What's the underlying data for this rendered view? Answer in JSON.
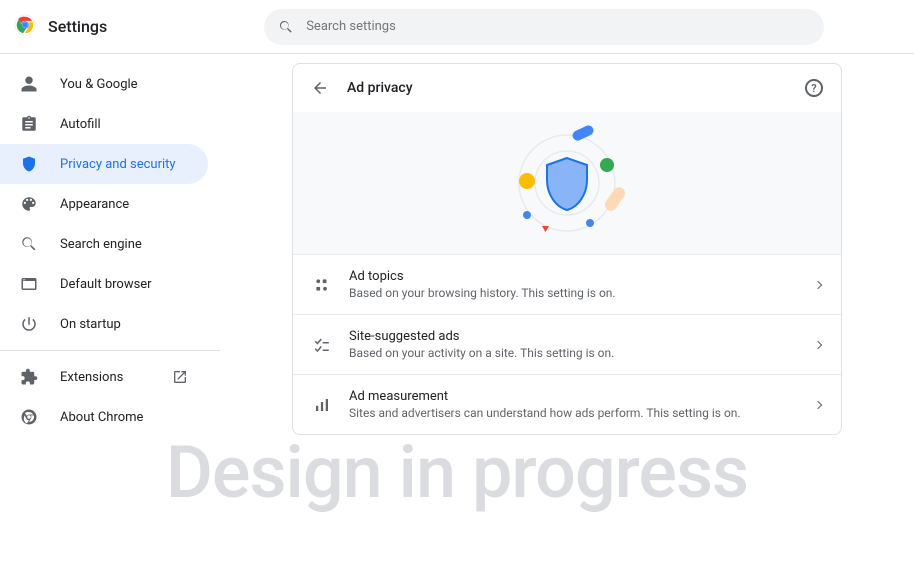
{
  "app": {
    "title": "Settings"
  },
  "search": {
    "placeholder": "Search settings"
  },
  "sidebar": {
    "items": [
      {
        "label": "You & Google"
      },
      {
        "label": "Autofill"
      },
      {
        "label": "Privacy and security"
      },
      {
        "label": "Appearance"
      },
      {
        "label": "Search engine"
      },
      {
        "label": "Default browser"
      },
      {
        "label": "On startup"
      }
    ],
    "footer": [
      {
        "label": "Extensions"
      },
      {
        "label": "About Chrome"
      }
    ]
  },
  "content": {
    "header_title": "Ad privacy",
    "rows": [
      {
        "title": "Ad topics",
        "desc": "Based on your browsing history. This setting is on."
      },
      {
        "title": "Site-suggested ads",
        "desc": "Based on your activity on a site. This setting is on."
      },
      {
        "title": "Ad measurement",
        "desc": "Sites and advertisers can understand how ads perform. This setting is on."
      }
    ]
  },
  "watermark": "Design in progress"
}
